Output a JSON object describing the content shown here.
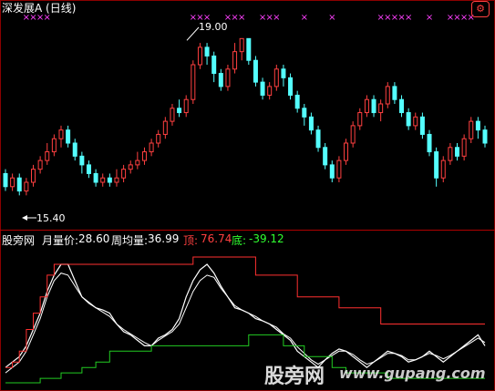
{
  "title": "深发展A (日线)",
  "settings_icon": "gear-icon",
  "annotations": {
    "high": "19.00",
    "low": "15.40"
  },
  "legend": {
    "name": "股旁网",
    "monthly_label": "月量价:",
    "monthly_value": "28.60",
    "weekly_label": "周均量:",
    "weekly_value": "36.99",
    "top_label": "顶:",
    "top_value": "76.74",
    "bottom_label": "底:",
    "bottom_value": "-39.12"
  },
  "watermark": {
    "cn": "股旁网",
    "url": "www.gupang.com"
  },
  "colors": {
    "up": "#ff4040",
    "down": "#54ffff",
    "signal": "#ff40ff",
    "top": "#ff3030",
    "bottom": "#22cc22",
    "line": "#ffffff",
    "label_top": "#ff4040",
    "label_bottom": "#30ff30"
  },
  "chart_data": [
    {
      "type": "candlestick",
      "title": "深发展A (日线)",
      "ylim": [
        14.8,
        19.3
      ],
      "annotations": [
        {
          "label": "19.00",
          "value": 19.0
        },
        {
          "label": "15.40",
          "value": 15.4
        }
      ],
      "candles": [
        [
          15.9,
          15.6,
          16.0,
          15.5
        ],
        [
          15.6,
          15.8,
          15.9,
          15.5
        ],
        [
          15.8,
          15.5,
          15.9,
          15.4
        ],
        [
          15.5,
          15.7,
          15.8,
          15.4
        ],
        [
          15.7,
          16.0,
          16.1,
          15.6
        ],
        [
          16.0,
          16.2,
          16.3,
          15.9
        ],
        [
          16.2,
          16.4,
          16.6,
          16.1
        ],
        [
          16.4,
          16.7,
          16.8,
          16.3
        ],
        [
          16.7,
          16.9,
          17.0,
          16.5
        ],
        [
          16.9,
          16.6,
          17.0,
          16.5
        ],
        [
          16.6,
          16.3,
          16.7,
          16.2
        ],
        [
          16.3,
          16.1,
          16.4,
          15.9
        ],
        [
          16.1,
          15.9,
          16.2,
          15.8
        ],
        [
          15.9,
          15.7,
          16.0,
          15.6
        ],
        [
          15.7,
          15.8,
          15.9,
          15.6
        ],
        [
          15.8,
          15.7,
          15.9,
          15.6
        ],
        [
          15.7,
          15.8,
          16.0,
          15.6
        ],
        [
          15.8,
          16.0,
          16.1,
          15.7
        ],
        [
          16.0,
          16.1,
          16.2,
          15.9
        ],
        [
          16.1,
          16.2,
          16.4,
          16.0
        ],
        [
          16.2,
          16.4,
          16.5,
          16.1
        ],
        [
          16.4,
          16.6,
          16.7,
          16.3
        ],
        [
          16.6,
          16.8,
          16.9,
          16.5
        ],
        [
          16.8,
          17.1,
          17.2,
          16.7
        ],
        [
          17.1,
          17.4,
          17.5,
          17.0
        ],
        [
          17.4,
          17.3,
          17.6,
          17.2
        ],
        [
          17.3,
          17.6,
          17.7,
          17.2
        ],
        [
          17.6,
          18.4,
          18.5,
          17.5
        ],
        [
          18.4,
          18.8,
          18.9,
          18.3
        ],
        [
          18.8,
          18.6,
          18.9,
          18.4
        ],
        [
          18.6,
          18.2,
          18.7,
          18.0
        ],
        [
          18.2,
          17.9,
          18.3,
          17.8
        ],
        [
          17.9,
          18.3,
          18.4,
          17.8
        ],
        [
          18.3,
          18.7,
          18.9,
          18.2
        ],
        [
          18.7,
          19.0,
          19.0,
          18.5
        ],
        [
          19.0,
          18.5,
          19.0,
          18.4
        ],
        [
          18.5,
          18.0,
          18.6,
          17.9
        ],
        [
          18.0,
          17.7,
          18.1,
          17.6
        ],
        [
          17.7,
          17.9,
          18.0,
          17.6
        ],
        [
          17.9,
          18.3,
          18.4,
          17.8
        ],
        [
          18.3,
          18.1,
          18.4,
          17.9
        ],
        [
          18.1,
          17.7,
          18.2,
          17.6
        ],
        [
          17.7,
          17.4,
          17.8,
          17.3
        ],
        [
          17.4,
          17.2,
          17.5,
          17.0
        ],
        [
          17.2,
          16.9,
          17.3,
          16.8
        ],
        [
          16.9,
          16.5,
          17.0,
          16.4
        ],
        [
          16.5,
          16.1,
          16.6,
          16.0
        ],
        [
          16.1,
          15.8,
          16.2,
          15.7
        ],
        [
          15.8,
          16.2,
          16.3,
          15.7
        ],
        [
          16.2,
          16.6,
          16.7,
          16.1
        ],
        [
          16.6,
          17.0,
          17.1,
          16.5
        ],
        [
          17.0,
          17.3,
          17.4,
          16.9
        ],
        [
          17.3,
          17.6,
          17.7,
          17.2
        ],
        [
          17.6,
          17.3,
          17.7,
          17.2
        ],
        [
          17.3,
          17.5,
          17.6,
          17.1
        ],
        [
          17.5,
          17.9,
          18.0,
          17.4
        ],
        [
          17.9,
          17.6,
          18.0,
          17.5
        ],
        [
          17.6,
          17.3,
          17.7,
          17.2
        ],
        [
          17.3,
          17.0,
          17.4,
          16.9
        ],
        [
          17.0,
          17.2,
          17.3,
          16.9
        ],
        [
          17.2,
          16.8,
          17.3,
          16.7
        ],
        [
          16.8,
          16.4,
          16.9,
          16.3
        ],
        [
          16.4,
          15.8,
          16.5,
          15.6
        ],
        [
          15.8,
          16.2,
          16.3,
          15.7
        ],
        [
          16.2,
          16.5,
          16.6,
          16.1
        ],
        [
          16.5,
          16.3,
          16.6,
          16.2
        ],
        [
          16.3,
          16.7,
          16.8,
          16.2
        ],
        [
          16.7,
          17.1,
          17.2,
          16.6
        ],
        [
          17.1,
          16.9,
          17.2,
          16.7
        ],
        [
          16.9,
          16.6,
          17.0,
          16.5
        ]
      ],
      "signal_groups": [
        3,
        4,
        5,
        6,
        27,
        28,
        29,
        32,
        33,
        34,
        37,
        38,
        39,
        43,
        47,
        54,
        55,
        56,
        57,
        58,
        61,
        64,
        65,
        66,
        67
      ]
    },
    {
      "type": "line",
      "ylim": [
        -39.12,
        76.74
      ],
      "series": [
        {
          "name": "月量价",
          "values": [
            -25,
            -20,
            -15,
            -5,
            10,
            25,
            45,
            60,
            70,
            70,
            55,
            40,
            35,
            30,
            28,
            25,
            15,
            8,
            5,
            0,
            -5,
            -5,
            2,
            5,
            10,
            20,
            40,
            55,
            65,
            70,
            62,
            50,
            40,
            30,
            28,
            25,
            20,
            18,
            15,
            10,
            5,
            0,
            -10,
            -15,
            -20,
            -25,
            -18,
            -12,
            -8,
            -10,
            -15,
            -20,
            -25,
            -20,
            -15,
            -10,
            -12,
            -15,
            -20,
            -18,
            -15,
            -10,
            -15,
            -20,
            -15,
            -10,
            -5,
            0,
            5,
            -5
          ]
        },
        {
          "name": "周均量",
          "values": [
            -30,
            -25,
            -20,
            -10,
            5,
            20,
            40,
            55,
            62,
            60,
            50,
            40,
            34,
            30,
            26,
            22,
            15,
            10,
            6,
            2,
            -2,
            -5,
            0,
            4,
            8,
            15,
            30,
            45,
            55,
            60,
            58,
            48,
            40,
            32,
            28,
            25,
            22,
            18,
            15,
            12,
            6,
            2,
            -6,
            -12,
            -18,
            -22,
            -18,
            -14,
            -10,
            -10,
            -13,
            -18,
            -22,
            -20,
            -16,
            -12,
            -12,
            -14,
            -18,
            -18,
            -15,
            -12,
            -14,
            -17,
            -14,
            -10,
            -6,
            -2,
            2,
            -2
          ]
        },
        {
          "name": "顶",
          "values": [
            -25,
            -20,
            -10,
            10,
            25,
            40,
            60,
            70,
            70,
            70,
            70,
            70,
            70,
            70,
            70,
            70,
            70,
            70,
            70,
            70,
            70,
            70,
            70,
            70,
            70,
            70,
            70,
            76.74,
            76.74,
            76.74,
            76.74,
            76.74,
            76.74,
            76.74,
            76.74,
            76.74,
            60,
            60,
            60,
            60,
            60,
            60,
            40,
            40,
            40,
            40,
            40,
            40,
            30,
            30,
            30,
            30,
            30,
            30,
            15,
            15,
            15,
            15,
            15,
            15,
            15,
            15,
            15,
            15,
            15,
            15,
            15,
            15,
            15,
            15
          ]
        },
        {
          "name": "底",
          "values": [
            -39.12,
            -39.12,
            -39.12,
            -39.12,
            -39.12,
            -35,
            -35,
            -35,
            -30,
            -30,
            -30,
            -25,
            -25,
            -20,
            -20,
            -10,
            -10,
            -10,
            -10,
            -10,
            -10,
            -5,
            -5,
            -5,
            -5,
            -5,
            -5,
            -5,
            -5,
            -5,
            -5,
            -5,
            -5,
            -5,
            -5,
            5,
            5,
            5,
            5,
            5,
            -5,
            -5,
            -5,
            -15,
            -15,
            -15,
            -15,
            -25,
            -25,
            -30,
            -30,
            -30,
            -30,
            -30,
            -30,
            -35,
            -35,
            -35,
            -35,
            -35,
            -35,
            -35,
            -35,
            -35,
            -35,
            -35,
            -35,
            -35,
            -35,
            -35
          ]
        }
      ]
    }
  ]
}
